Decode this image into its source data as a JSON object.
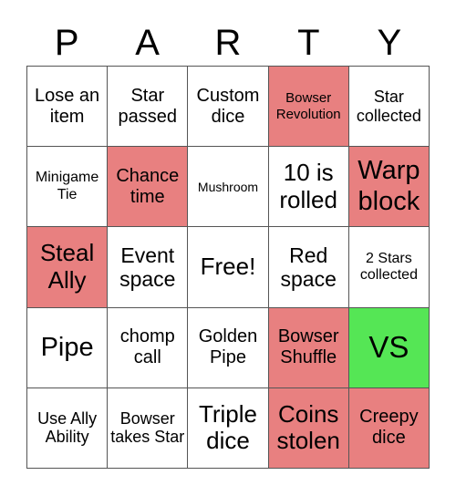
{
  "header": {
    "letters": [
      "P",
      "A",
      "R",
      "T",
      "Y"
    ]
  },
  "colors": {
    "marked": "#e88080",
    "free": "#55e655",
    "unmarked": "#ffffff"
  },
  "cells": [
    {
      "text": "Lose an item",
      "state": "unmarked"
    },
    {
      "text": "Star passed",
      "state": "unmarked"
    },
    {
      "text": "Custom dice",
      "state": "unmarked"
    },
    {
      "text": "Bowser Revolution",
      "state": "marked"
    },
    {
      "text": "Star collected",
      "state": "unmarked"
    },
    {
      "text": "Minigame Tie",
      "state": "unmarked"
    },
    {
      "text": "Chance time",
      "state": "marked"
    },
    {
      "text": "Mushroom",
      "state": "unmarked"
    },
    {
      "text": "10 is rolled",
      "state": "unmarked"
    },
    {
      "text": "Warp block",
      "state": "marked"
    },
    {
      "text": "Steal Ally",
      "state": "marked"
    },
    {
      "text": "Event space",
      "state": "unmarked"
    },
    {
      "text": "Free!",
      "state": "unmarked"
    },
    {
      "text": "Red space",
      "state": "unmarked"
    },
    {
      "text": "2 Stars collected",
      "state": "unmarked"
    },
    {
      "text": "Pipe",
      "state": "unmarked"
    },
    {
      "text": "chomp call",
      "state": "unmarked"
    },
    {
      "text": "Golden Pipe",
      "state": "unmarked"
    },
    {
      "text": "Bowser Shuffle",
      "state": "marked"
    },
    {
      "text": "VS",
      "state": "free"
    },
    {
      "text": "Use Ally Ability",
      "state": "unmarked"
    },
    {
      "text": "Bowser takes Star",
      "state": "unmarked"
    },
    {
      "text": "Triple dice",
      "state": "unmarked"
    },
    {
      "text": "Coins stolen",
      "state": "marked"
    },
    {
      "text": "Creepy dice",
      "state": "marked"
    }
  ]
}
